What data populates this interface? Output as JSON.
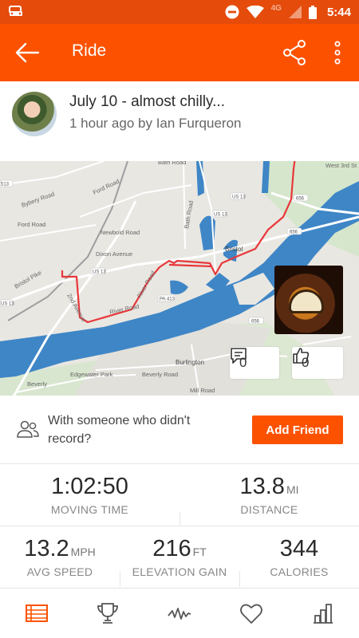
{
  "status_bar": {
    "network": "4G",
    "time": "5:44",
    "icons": [
      "car-icon",
      "do-not-disturb-icon",
      "wifi-icon",
      "signal-icon",
      "battery-icon"
    ]
  },
  "app_bar": {
    "title": "Ride",
    "icons": [
      "back-arrow-icon",
      "share-icon",
      "more-vert-icon"
    ]
  },
  "activity": {
    "title": "July 10 - almost chilly...",
    "subtitle": "1 hour ago by Ian Furqueron"
  },
  "map": {
    "labels": {
      "bath_road": "Bath Road",
      "bybery_road": "Bybery Road",
      "ford_road_a": "Ford Road",
      "ford_road_b": "Ford Road",
      "newbold_road": "Newbold Road",
      "dixon_avenue": "Dixon Avenue",
      "bristol_pike": "Bristol Pike",
      "second_avenue": "2nd Avenue",
      "river_road_a": "River Road",
      "river_road_b": "River Road",
      "bristol": "Bristol",
      "burlington": "Burlington",
      "edgewater_park": "Edgewater Park",
      "beverly": "Beverly",
      "beverly_road": "Beverly Road",
      "mill_road": "Mill Road",
      "west_3rd_st": "West 3rd St",
      "us13_a": "US 13",
      "us13_b": "US 13",
      "us13_c": "US 13",
      "us13_d": "US 13",
      "pa413": "PA 413",
      "route_656": "656",
      "route_656b": "656",
      "route_656c": "656",
      "i513": "513"
    },
    "comments_count": "0",
    "kudos_count": "0",
    "route_color": "#e8373a",
    "water_color": "#3f86c6"
  },
  "with_someone": {
    "text": "With someone who didn't record?",
    "button_label": "Add Friend"
  },
  "stats": {
    "moving_time": {
      "value": "1:02:50",
      "unit": "",
      "label": "MOVING TIME"
    },
    "distance": {
      "value": "13.8",
      "unit": "MI",
      "label": "DISTANCE"
    },
    "avg_speed": {
      "value": "13.2",
      "unit": "MPH",
      "label": "AVG SPEED"
    },
    "elevation_gain": {
      "value": "216",
      "unit": "FT",
      "label": "ELEVATION GAIN"
    },
    "calories": {
      "value": "344",
      "unit": "",
      "label": "CALORIES"
    }
  },
  "bottom_nav": {
    "items": [
      "overview-icon",
      "trophy-icon",
      "analysis-icon",
      "heart-icon",
      "bar-chart-icon"
    ],
    "active": "overview-icon",
    "active_color": "#fc5200",
    "inactive_color": "#555555"
  },
  "colors": {
    "brand": "#fc5200",
    "status_bar": "#e54c0c"
  }
}
